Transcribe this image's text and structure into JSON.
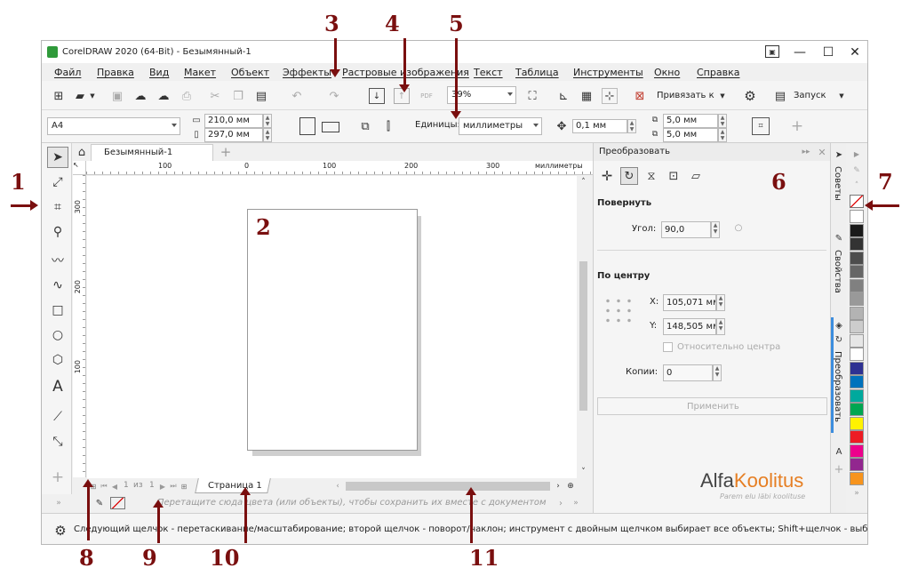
{
  "window": {
    "title": "CorelDRAW 2020 (64-Bit) - Безымянный-1",
    "buttons": [
      "—",
      "☐",
      "✕"
    ]
  },
  "menu": [
    {
      "label": "Файл"
    },
    {
      "label": "Правка"
    },
    {
      "label": "Вид"
    },
    {
      "label": "Макет"
    },
    {
      "label": "Объект"
    },
    {
      "label": "Эффекты"
    },
    {
      "label": "Растровые изображения"
    },
    {
      "label": "Текст"
    },
    {
      "label": "Таблица"
    },
    {
      "label": "Инструменты"
    },
    {
      "label": "Окно"
    },
    {
      "label": "Справка"
    }
  ],
  "standard_toolbar": {
    "zoom_value": "39%",
    "snap_label": "Привязать к",
    "launch_label": "Запуск",
    "pdf_label": "PDF"
  },
  "property_bar": {
    "page_size": "A4",
    "width": "210,0 мм",
    "height": "297,0 мм",
    "units_label": "Единицы:",
    "units_value": "миллиметры",
    "nudge": "0,1 мм",
    "dup_x": "5,0 мм",
    "dup_y": "5,0 мм"
  },
  "doc_tab": {
    "label": "Безымянный-1",
    "add": "+"
  },
  "ruler": {
    "units": "миллиметры",
    "top_ticks": [
      "100",
      "0",
      "100",
      "200",
      "300"
    ],
    "left_ticks": [
      "300",
      "200",
      "100"
    ]
  },
  "page_nav": {
    "current": "1",
    "of_label": "из",
    "total": "1",
    "page_tab": "Страница 1"
  },
  "status_hint": "Перетащите сюда цвета (или объекты), чтобы сохранить их вместе с документом",
  "status_text": "Следующий щелчок - перетаскивание/масштабирование; второй щелчок - поворот/наклон; инструмент с двойным щелчком выбирает все объекты; Shift+щелчок - выбор",
  "docker": {
    "title": "Преобразовать",
    "rotate_title": "Повернуть",
    "angle_label": "Угол:",
    "angle_value": "90,0",
    "center_title": "По центру",
    "x_label": "X:",
    "x_value": "105,071 мм",
    "y_label": "Y:",
    "y_value": "148,505 мм",
    "relative_label": "Относительно центра",
    "copies_label": "Копии:",
    "copies_value": "0",
    "apply_label": "Применить"
  },
  "docker_tabs": [
    "Советы",
    "Свойства",
    "Преобразовать"
  ],
  "watermark": {
    "brand": "AlfaKoolitus",
    "brand_a": "Alfa",
    "brand_b": "Koolitus",
    "tagline": "Parem elu läbi koolituse"
  },
  "palette": [
    "#ffffff",
    "#1a1a1a",
    "#333333",
    "#4d4d4d",
    "#666666",
    "#808080",
    "#999999",
    "#b3b3b3",
    "#cccccc",
    "#e6e6e6",
    "#ffffff",
    "#2e3192",
    "#0072bc",
    "#00a99d",
    "#00a651",
    "#fff200",
    "#ed1c24",
    "#ec008c",
    "#92278f",
    "#f7941d"
  ],
  "callouts": [
    "1",
    "2",
    "3",
    "4",
    "5",
    "6",
    "7",
    "8",
    "9",
    "10",
    "11"
  ]
}
